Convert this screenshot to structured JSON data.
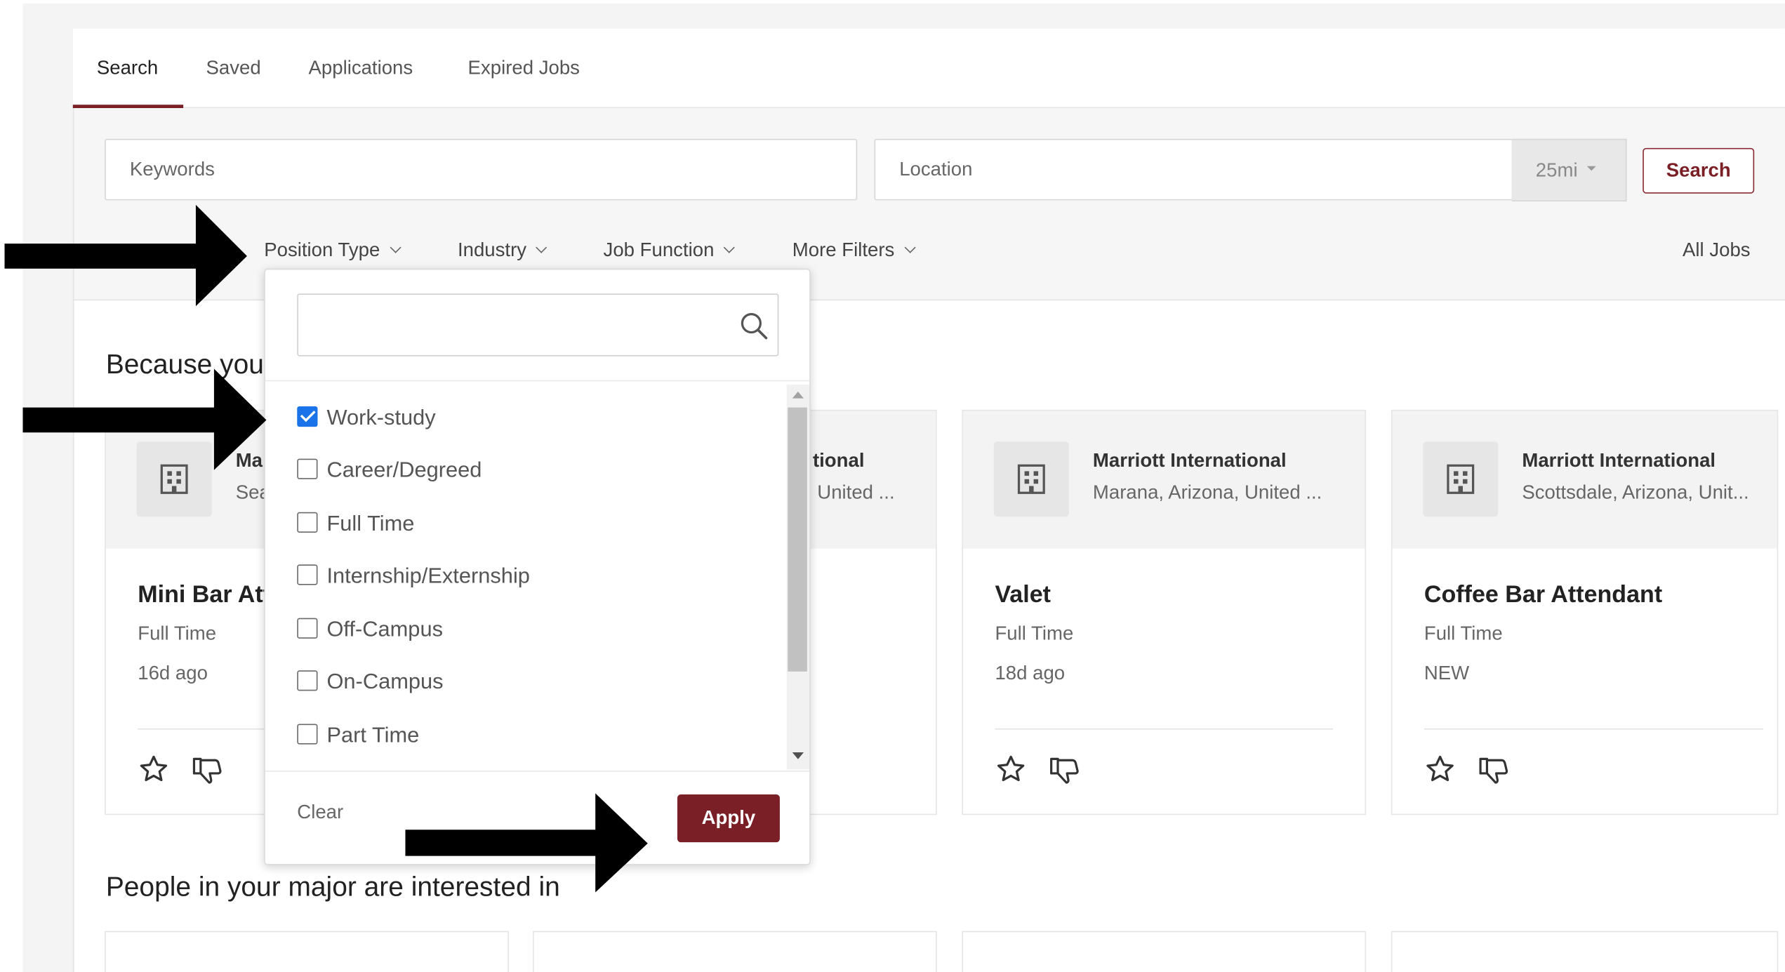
{
  "tabs": [
    {
      "label": "Search",
      "active": true
    },
    {
      "label": "Saved",
      "active": false
    },
    {
      "label": "Applications",
      "active": false
    },
    {
      "label": "Expired Jobs",
      "active": false
    }
  ],
  "search": {
    "keywords_placeholder": "Keywords",
    "location_placeholder": "Location",
    "radius": "25mi",
    "button_label": "Search"
  },
  "filters": {
    "position_type": "Position Type",
    "industry": "Industry",
    "job_function": "Job Function",
    "more_filters": "More Filters",
    "all_jobs": "All Jobs"
  },
  "sections": {
    "because_you": "Because you",
    "people_in_major": "People in your major are interested in"
  },
  "cards": [
    {
      "company": "Ma",
      "location": "Sea",
      "title": "Mini Bar Att",
      "type": "Full Time",
      "age": "16d ago"
    },
    {
      "company": "tional",
      "location": "n, United ...",
      "title": "",
      "type": "",
      "age": ""
    },
    {
      "company": "Marriott International",
      "location": "Marana, Arizona, United ...",
      "title": "Valet",
      "type": "Full Time",
      "age": "18d ago"
    },
    {
      "company": "Marriott International",
      "location": "Scottsdale, Arizona, Unit...",
      "title": "Coffee Bar Attendant",
      "type": "Full Time",
      "age": "NEW"
    }
  ],
  "dropdown": {
    "search_value": "",
    "options": [
      {
        "label": "Work-study",
        "checked": true
      },
      {
        "label": "Career/Degreed",
        "checked": false
      },
      {
        "label": "Full Time",
        "checked": false
      },
      {
        "label": "Internship/Externship",
        "checked": false
      },
      {
        "label": "Off-Campus",
        "checked": false
      },
      {
        "label": "On-Campus",
        "checked": false
      },
      {
        "label": "Part Time",
        "checked": false
      }
    ],
    "clear_label": "Clear",
    "apply_label": "Apply"
  },
  "colors": {
    "brand": "#7a1f25",
    "checkbox": "#1a73e8",
    "arrow": "#000000"
  },
  "icons": [
    "building-icon",
    "star-icon",
    "thumbs-down-icon",
    "search-icon",
    "chevron-down-icon",
    "arrow-right-icon"
  ]
}
